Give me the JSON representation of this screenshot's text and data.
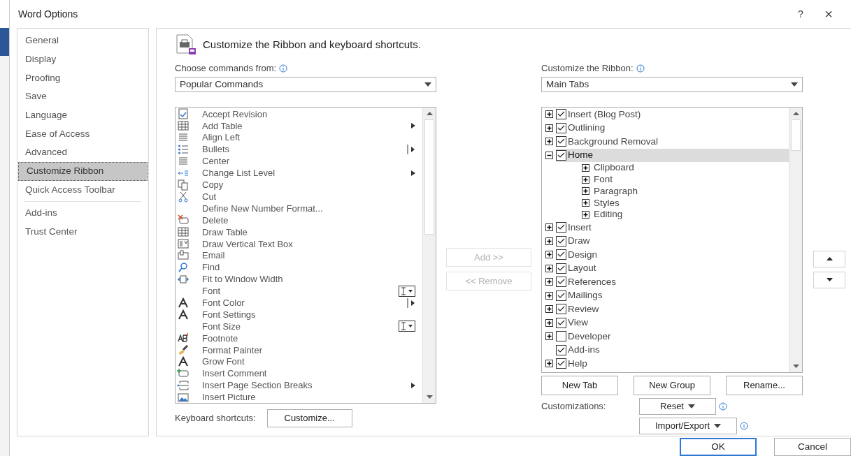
{
  "window": {
    "title": "Word Options",
    "help": "?",
    "close": "×"
  },
  "sidebar": {
    "items": [
      {
        "label": "General",
        "selected": false
      },
      {
        "label": "Display",
        "selected": false
      },
      {
        "label": "Proofing",
        "selected": false
      },
      {
        "label": "Save",
        "selected": false
      },
      {
        "label": "Language",
        "selected": false
      },
      {
        "label": "Ease of Access",
        "selected": false
      },
      {
        "label": "Advanced",
        "selected": false
      },
      {
        "label": "Customize Ribbon",
        "selected": true
      },
      {
        "label": "Quick Access Toolbar",
        "selected": false
      },
      {
        "label": "Add-ins",
        "selected": false
      },
      {
        "label": "Trust Center",
        "selected": false
      }
    ]
  },
  "heading": "Customize the Ribbon and keyboard shortcuts.",
  "commands_from": {
    "label": "Choose commands from:",
    "value": "Popular Commands"
  },
  "commands": [
    {
      "label": "Accept Revision",
      "kind": "check",
      "submenu": false,
      "split": false,
      "size_box": false
    },
    {
      "label": "Add Table",
      "kind": "table",
      "submenu": true,
      "split": false,
      "size_box": false
    },
    {
      "label": "Align Left",
      "kind": "lines",
      "submenu": false,
      "split": false,
      "size_box": false
    },
    {
      "label": "Bullets",
      "kind": "bullets",
      "submenu": false,
      "split": true,
      "size_box": false
    },
    {
      "label": "Center",
      "kind": "lines",
      "submenu": false,
      "split": false,
      "size_box": false
    },
    {
      "label": "Change List Level",
      "kind": "indent",
      "submenu": true,
      "split": false,
      "size_box": false
    },
    {
      "label": "Copy",
      "kind": "copy",
      "submenu": false,
      "split": false,
      "size_box": false
    },
    {
      "label": "Cut",
      "kind": "scissors",
      "submenu": false,
      "split": false,
      "size_box": false
    },
    {
      "label": "Define New Number Format...",
      "kind": "none",
      "submenu": false,
      "split": false,
      "size_box": false
    },
    {
      "label": "Delete",
      "kind": "delete",
      "submenu": false,
      "split": false,
      "size_box": false
    },
    {
      "label": "Draw Table",
      "kind": "table",
      "submenu": false,
      "split": false,
      "size_box": false
    },
    {
      "label": "Draw Vertical Text Box",
      "kind": "textbox",
      "submenu": false,
      "split": false,
      "size_box": false
    },
    {
      "label": "Email",
      "kind": "mail",
      "submenu": false,
      "split": false,
      "size_box": false
    },
    {
      "label": "Find",
      "kind": "search",
      "submenu": false,
      "split": false,
      "size_box": false
    },
    {
      "label": "Fit to Window Width",
      "kind": "fit",
      "submenu": false,
      "split": false,
      "size_box": false
    },
    {
      "label": "Font",
      "kind": "none",
      "submenu": false,
      "split": false,
      "size_box": true
    },
    {
      "label": "Font Color",
      "kind": "letter",
      "submenu": false,
      "split": true,
      "size_box": false
    },
    {
      "label": "Font Settings",
      "kind": "letter",
      "submenu": false,
      "split": false,
      "size_box": false
    },
    {
      "label": "Font Size",
      "kind": "none",
      "submenu": false,
      "split": false,
      "size_box": true
    },
    {
      "label": "Footnote",
      "kind": "footnote",
      "submenu": false,
      "split": false,
      "size_box": false
    },
    {
      "label": "Format Painter",
      "kind": "brush",
      "submenu": false,
      "split": false,
      "size_box": false
    },
    {
      "label": "Grow Font",
      "kind": "letter",
      "submenu": false,
      "split": false,
      "size_box": false
    },
    {
      "label": "Insert Comment",
      "kind": "comment",
      "submenu": false,
      "split": false,
      "size_box": false
    },
    {
      "label": "Insert Page  Section Breaks",
      "kind": "pagebreak",
      "submenu": true,
      "split": false,
      "size_box": false
    },
    {
      "label": "Insert Picture",
      "kind": "picture",
      "submenu": false,
      "split": false,
      "size_box": false
    }
  ],
  "add_button": {
    "label": "Add >>",
    "disabled": true
  },
  "remove_button": {
    "label": "<< Remove",
    "disabled": true
  },
  "customize_ribbon": {
    "label": "Customize the Ribbon:",
    "value": "Main Tabs"
  },
  "ribbon_tabs": [
    {
      "label": "Insert (Blog Post)",
      "checked": true,
      "expander": true,
      "expanded": false,
      "selected": false
    },
    {
      "label": "Outlining",
      "checked": true,
      "expander": true,
      "expanded": false,
      "selected": false
    },
    {
      "label": "Background Removal",
      "checked": true,
      "expander": true,
      "expanded": false,
      "selected": false
    },
    {
      "label": "Home",
      "checked": true,
      "expander": true,
      "expanded": true,
      "selected": true,
      "children": [
        {
          "label": "Clipboard"
        },
        {
          "label": "Font"
        },
        {
          "label": "Paragraph"
        },
        {
          "label": "Styles"
        },
        {
          "label": "Editing"
        }
      ]
    },
    {
      "label": "Insert",
      "checked": true,
      "expander": true,
      "expanded": false,
      "selected": false
    },
    {
      "label": "Draw",
      "checked": true,
      "expander": true,
      "expanded": false,
      "selected": false
    },
    {
      "label": "Design",
      "checked": true,
      "expander": true,
      "expanded": false,
      "selected": false
    },
    {
      "label": "Layout",
      "checked": true,
      "expander": true,
      "expanded": false,
      "selected": false
    },
    {
      "label": "References",
      "checked": true,
      "expander": true,
      "expanded": false,
      "selected": false
    },
    {
      "label": "Mailings",
      "checked": true,
      "expander": true,
      "expanded": false,
      "selected": false
    },
    {
      "label": "Review",
      "checked": true,
      "expander": true,
      "expanded": false,
      "selected": false
    },
    {
      "label": "View",
      "checked": true,
      "expander": true,
      "expanded": false,
      "selected": false
    },
    {
      "label": "Developer",
      "checked": false,
      "expander": true,
      "expanded": false,
      "selected": false
    },
    {
      "label": "Add-ins",
      "checked": true,
      "expander": false,
      "expanded": false,
      "selected": false
    },
    {
      "label": "Help",
      "checked": true,
      "expander": true,
      "expanded": false,
      "selected": false
    }
  ],
  "tab_buttons": [
    "New Tab",
    "New Group",
    "Rename..."
  ],
  "customizations": {
    "label": "Customizations:",
    "reset": "Reset",
    "import_export": "Import/Export"
  },
  "keyboard_shortcuts": {
    "label": "Keyboard shortcuts:",
    "button": "Customize..."
  },
  "footer_buttons": [
    {
      "label": "OK",
      "kind": "default"
    },
    {
      "label": "Cancel",
      "kind": "normal"
    }
  ]
}
